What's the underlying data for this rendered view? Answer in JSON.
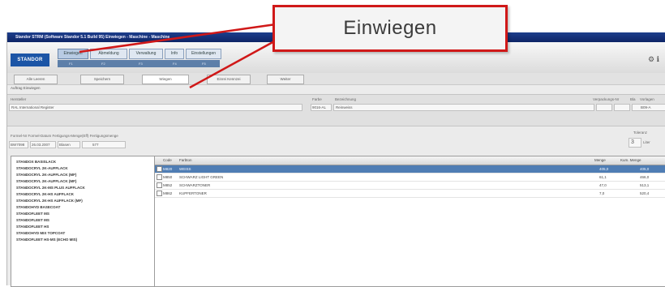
{
  "window": {
    "title": "Standor STRM (Software Standor 5.1 Build 95) Einwiegen - Maschine - Maschine",
    "title_extra": "Maschine"
  },
  "logo": "STANDOR",
  "tabs": [
    {
      "label": "Einwiegen",
      "active": true
    },
    {
      "label": "Abmeldung",
      "active": false
    },
    {
      "label": "Verwaltung",
      "active": false
    },
    {
      "label": "Info",
      "active": false
    },
    {
      "label": "Einstellungen",
      "active": false
    }
  ],
  "tab_sub": [
    "F1",
    "F2",
    "F3",
    "F4",
    "F5"
  ],
  "toolbar_icons": "⚙ ℹ",
  "buttons": [
    {
      "label": "Alle Leeren",
      "active": false
    },
    {
      "label": "Speichern",
      "active": false
    },
    {
      "label": "Wiegen",
      "active": true
    },
    {
      "label": "Einrei Kennzei",
      "active": false
    },
    {
      "label": "Weiter",
      "active": false
    }
  ],
  "subtitle": "Auftrag Einwiegen",
  "info": {
    "hersteller_label": "Hersteller",
    "hersteller_value": "RAL International Register",
    "farbe_label": "Farbe",
    "farbe_value": "9016-AL",
    "bez_label": "Bezeichnung",
    "bez_value": "Reinweiss",
    "verpackung_label": "Verpackungs-Nr",
    "bla_label": "Bla",
    "vorlage_label": "Vorlagen",
    "vorlage_value": "B09-A",
    "formel_label": "Formel-Nr  Formel-Datum  Fertigungs-Menge(Eff)  Fertigungsmenge",
    "formel_value1": "BW7098",
    "formel_value2": "26.03.2007",
    "formel_value3": "Blasen",
    "formel_value4": "577",
    "toleranz_label": "Toleranz",
    "toleranz_value": "3",
    "liter_label": "Liter"
  },
  "left_list": [
    "STANDOX BASISLACK",
    "STANDOCRYL 2K-AUFFLACK",
    "STANDOCRYL 2K-AUFFLACK (MF)",
    "STANDOCRYL 2K-AUFFLACK (MF)",
    "STANDOCRYL 2K-MS PLUS AUFFLACK",
    "STANDOCRYL 2K-HS AUFFLACK",
    "STANDOCRYL 2K-HS AUFFLACK (MF)",
    "STANDOHYD BASECOAT",
    "STANDOFLEET MS",
    "STANDOFLEET MS",
    "STANDOFLEET HS",
    "STANDOHYD MIX TOPCOAT",
    "STANDOFLEET HS-MS (ECHO MIS)"
  ],
  "grid": {
    "columns": [
      "Code",
      "Farbton",
      "Menge",
      "Kum. Menge"
    ],
    "rows": [
      {
        "code": "M820",
        "name": "WEISS",
        "menge": "405,0",
        "kum": "405,0",
        "selected": true
      },
      {
        "code": "M850",
        "name": "SCHWARZ LIGHT GREEN",
        "menge": "61,1",
        "kum": "466,0",
        "selected": false
      },
      {
        "code": "M852",
        "name": "SCHWARZTONER",
        "menge": "47,0",
        "kum": "513,1",
        "selected": false
      },
      {
        "code": "M862",
        "name": "KUPFERTONER",
        "menge": "7,0",
        "kum": "520,4",
        "selected": false
      }
    ]
  },
  "callout": {
    "text": "Einwiegen",
    "border_color": "#d01818"
  }
}
